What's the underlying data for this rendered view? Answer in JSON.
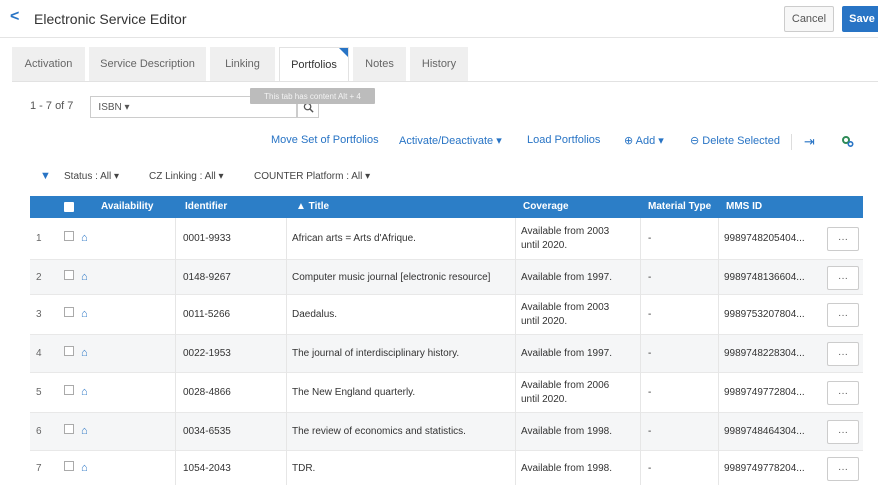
{
  "header": {
    "back_icon": "chevron-left-icon",
    "title": "Electronic Service Editor",
    "cancel_label": "Cancel",
    "save_label": "Save"
  },
  "tabs": [
    {
      "label": "Activation"
    },
    {
      "label": "Service Description"
    },
    {
      "label": "Linking"
    },
    {
      "label": "Portfolios",
      "active": true
    },
    {
      "label": "Notes"
    },
    {
      "label": "History"
    }
  ],
  "tooltip": "This tab has content Alt + 4",
  "results": {
    "count": "1 - 7 of 7"
  },
  "search": {
    "type_label": "ISBN ▾",
    "value": ""
  },
  "toolbar": {
    "move_set": "Move Set of Portfolios",
    "activate": "Activate/Deactivate ▾",
    "load": "Load Portfolios",
    "add": "Add ▾",
    "delete": "Delete Selected"
  },
  "filters": {
    "status": "Status : All ▾",
    "cz_linking": "CZ Linking : All ▾",
    "counter": "COUNTER Platform : All ▾"
  },
  "columns": {
    "availability": "Availability",
    "identifier": "Identifier",
    "title": "▲ Title",
    "coverage": "Coverage",
    "material_type": "Material Type",
    "mms_id": "MMS ID"
  },
  "rows": [
    {
      "num": "1",
      "identifier": "0001-9933",
      "title": "African arts = Arts d'Afrique.",
      "coverage_1": "Available from 2003",
      "coverage_2": "until 2020.",
      "material_type": "-",
      "mms_id": "9989748205404...",
      "more": "···"
    },
    {
      "num": "2",
      "identifier": "0148-9267",
      "title": "Computer music journal [electronic resource]",
      "coverage_1": "Available from 1997.",
      "coverage_2": "",
      "material_type": "-",
      "mms_id": "9989748136604...",
      "more": "···"
    },
    {
      "num": "3",
      "identifier": "0011-5266",
      "title": "Daedalus.",
      "coverage_1": "Available from 2003",
      "coverage_2": "until 2020.",
      "material_type": "-",
      "mms_id": "9989753207804...",
      "more": "···"
    },
    {
      "num": "4",
      "identifier": "0022-1953",
      "title": "The journal of interdisciplinary history.",
      "coverage_1": "Available from 1997.",
      "coverage_2": "",
      "material_type": "-",
      "mms_id": "9989748228304...",
      "more": "···"
    },
    {
      "num": "5",
      "identifier": "0028-4866",
      "title": "The New England quarterly.",
      "coverage_1": "Available from 2006",
      "coverage_2": "until 2020.",
      "material_type": "-",
      "mms_id": "9989749772804...",
      "more": "···"
    },
    {
      "num": "6",
      "identifier": "0034-6535",
      "title": "The review of economics and statistics.",
      "coverage_1": "Available from 1998.",
      "coverage_2": "",
      "material_type": "-",
      "mms_id": "9989748464304...",
      "more": "···"
    },
    {
      "num": "7",
      "identifier": "1054-2043",
      "title": "TDR.",
      "coverage_1": "Available from 1998.",
      "coverage_2": "",
      "material_type": "-",
      "mms_id": "9989749778204...",
      "more": "···"
    }
  ],
  "colors": {
    "accent": "#2874c5",
    "header_bg": "#2c7ec7",
    "settings_green": "#2e8b57"
  }
}
